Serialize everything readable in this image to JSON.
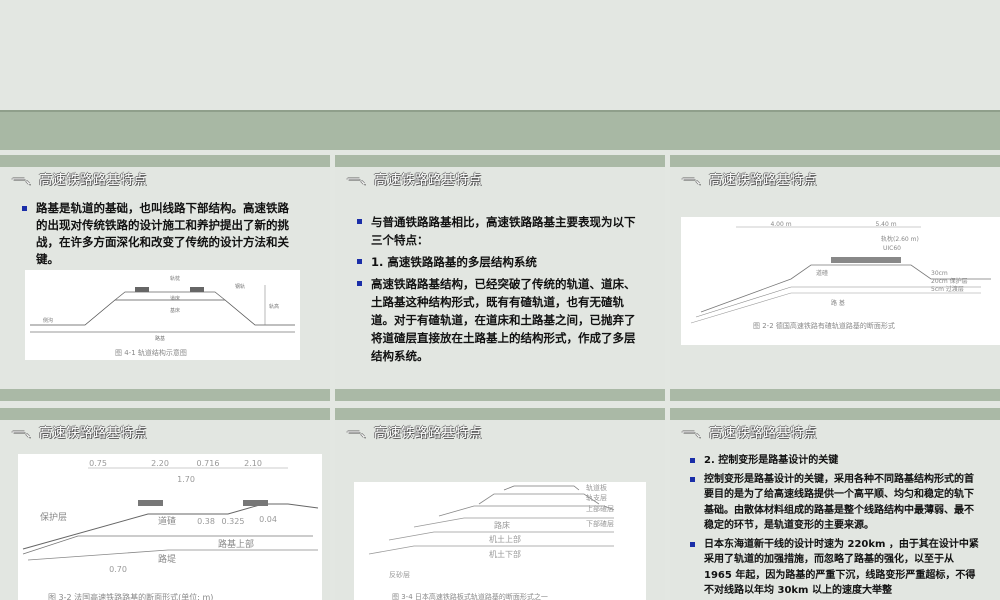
{
  "slides": [
    {
      "title": "一、高速铁路路基特点",
      "bullets": [
        "路基是轨道的基础，也叫线路下部结构。高速铁路的出现对传统铁路的设计施工和养护提出了新的挑战，在许多方面深化和改变了传统的设计方法和关键。"
      ],
      "figure": {
        "caption": "图 4-1  轨道结构示意图",
        "labels": {
          "sleeper": "轨枕",
          "rail": "钢轨",
          "ballast": "道床",
          "subgrade": "路基",
          "bottom": "基床",
          "ditch": "侧沟",
          "height": "轨高"
        }
      }
    },
    {
      "title": "一、高速铁路路基特点",
      "bullets": [
        "与普通铁路路基相比，高速铁路路基主要表现为以下三个特点：",
        "1. 高速铁路路基的多层结构系统",
        "高速铁路路基结构，已经突破了传统的轨道、道床、土路基这种结构形式，既有有碴轨道，也有无碴轨道。对于有碴轨道，在道床和土路基之间，已抛弃了将道碴层直接放在土路基上的结构形式，作成了多层结构系统。"
      ]
    },
    {
      "title": "一、高速铁路路基特点",
      "figure": {
        "caption": "图 2-2  德国高速铁路有碴轨道路基的断面形式",
        "labels": {
          "d1": "4.00 m",
          "d2": "5.40 m",
          "rail": "轨枕(2.60 m)",
          "uic": "UIC60",
          "ballast": "道碴",
          "c1": "30cm",
          "c2": "20cm 保护层",
          "c3": "5cm 过渡层",
          "base": "路  基"
        }
      }
    },
    {
      "title": "一、高速铁路路基特点",
      "figure": {
        "caption": "图 3-2  法国高速铁路路基的断面形式(单位: m)",
        "labels": {
          "d1": "0.75",
          "d2": "2.20",
          "d3": "0.716",
          "d4": "2.10",
          "d5": "1.70",
          "d6": "0.38",
          "d7": "0.325",
          "d8": "0.04",
          "d9": "0.70",
          "ballast": "道碴",
          "subgrade": "路基上部",
          "embank": "路堤",
          "protect": "保护层"
        }
      }
    },
    {
      "title": "一、高速铁路路基特点",
      "figure": {
        "caption": "图 3-4  日本高速铁路板式轨道路基的断面形式之一",
        "labels": {
          "slab": "轨道板",
          "support": "轨支层",
          "upper_ballast": "上部碴层",
          "lower_ballast": "下部碴层",
          "roadbed": "路床",
          "upper": "机土上部",
          "lower": "机土下部",
          "sand": "反砂层"
        }
      }
    },
    {
      "title": "一、高速铁路路基特点",
      "bullets": [
        "2. 控制变形是路基设计的关键",
        "控制变形是路基设计的关键，采用各种不同路基结构形式的首要目的是为了给高速线路提供一个高平顺、均匀和稳定的轨下基础。由散体材料组成的路基是整个线路结构中最薄弱、最不稳定的环节，是轨道变形的主要来源。",
        "日本东海道新干线的设计时速为 220km ，由于其在设计中紧采用了轨道的加强措施，而忽略了路基的强化，以至于从 1965 年起，因为路基的严重下沉，线路变形严重超标，不得不对线路以年均 30km 以上的速度大举整"
      ]
    }
  ]
}
